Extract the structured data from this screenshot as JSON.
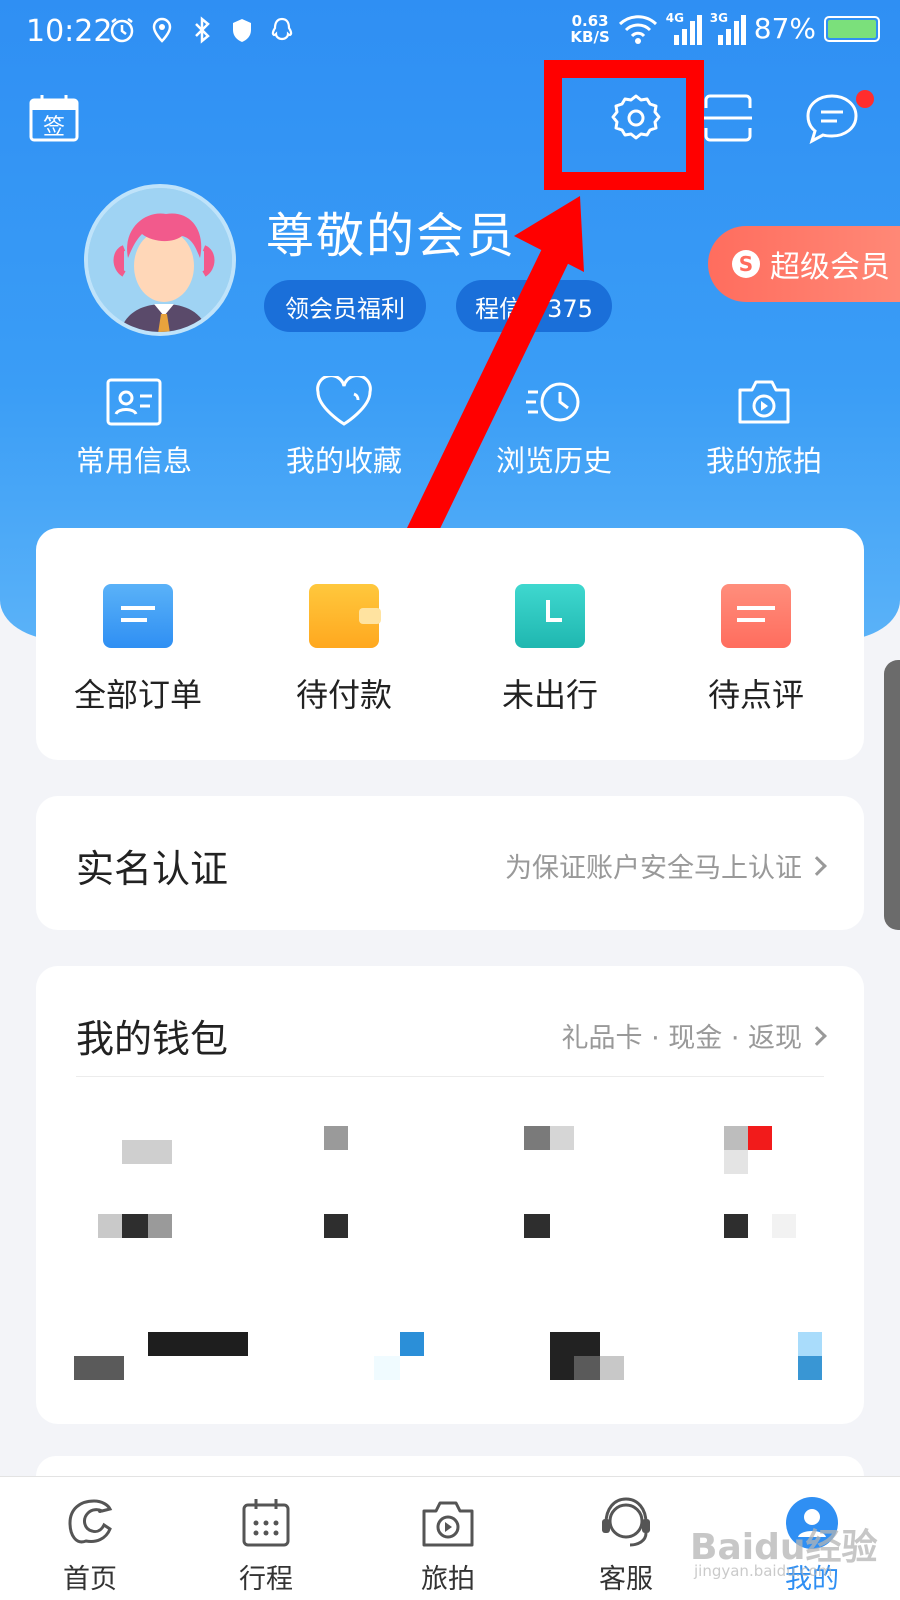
{
  "status_bar": {
    "time": "10:22",
    "net_speed_value": "0.63",
    "net_speed_unit": "KB/S",
    "signal_1": "4G",
    "signal_2": "3G",
    "battery_percent": "87%"
  },
  "header": {
    "icons": [
      "sign-in-calendar-icon",
      "settings-gear-icon",
      "scan-icon",
      "message-icon"
    ],
    "sign_in_label": "签",
    "has_unread_messages": true
  },
  "profile": {
    "name": "尊敬的会员",
    "benefit_pill": "领会员福利",
    "points_pill": "程信分375",
    "vip_badge": "超级会员"
  },
  "quick_links": [
    {
      "label": "常用信息",
      "icon": "id-card-icon"
    },
    {
      "label": "我的收藏",
      "icon": "heart-icon"
    },
    {
      "label": "浏览历史",
      "icon": "history-clock-icon"
    },
    {
      "label": "我的旅拍",
      "icon": "camera-icon"
    }
  ],
  "orders": [
    {
      "label": "全部订单",
      "icon": "all-orders-icon",
      "color": "#3a9df6"
    },
    {
      "label": "待付款",
      "icon": "wallet-icon",
      "color": "#ffb21f"
    },
    {
      "label": "未出行",
      "icon": "clock-icon",
      "color": "#27c7c0"
    },
    {
      "label": "待点评",
      "icon": "comment-icon",
      "color": "#ff7a68"
    }
  ],
  "verification": {
    "title": "实名认证",
    "subtitle": "为保证账户安全马上认证"
  },
  "wallet": {
    "title": "我的钱包",
    "subtitle": "礼品卡 · 现金 · 返现"
  },
  "tabs": [
    {
      "label": "首页",
      "icon": "home-dolphin-icon",
      "active": false
    },
    {
      "label": "行程",
      "icon": "itinerary-calendar-icon",
      "active": false
    },
    {
      "label": "旅拍",
      "icon": "travel-camera-icon",
      "active": false
    },
    {
      "label": "客服",
      "icon": "customer-service-icon",
      "active": false
    },
    {
      "label": "我的",
      "icon": "profile-icon",
      "active": true
    }
  ],
  "watermark": {
    "text": "Baidu经验",
    "sub": "jingyan.baidu.com"
  },
  "colors": {
    "brand_blue": "#2f8ff3",
    "highlight_red": "#ff0000",
    "vip_orange": "#ff6d5e"
  }
}
